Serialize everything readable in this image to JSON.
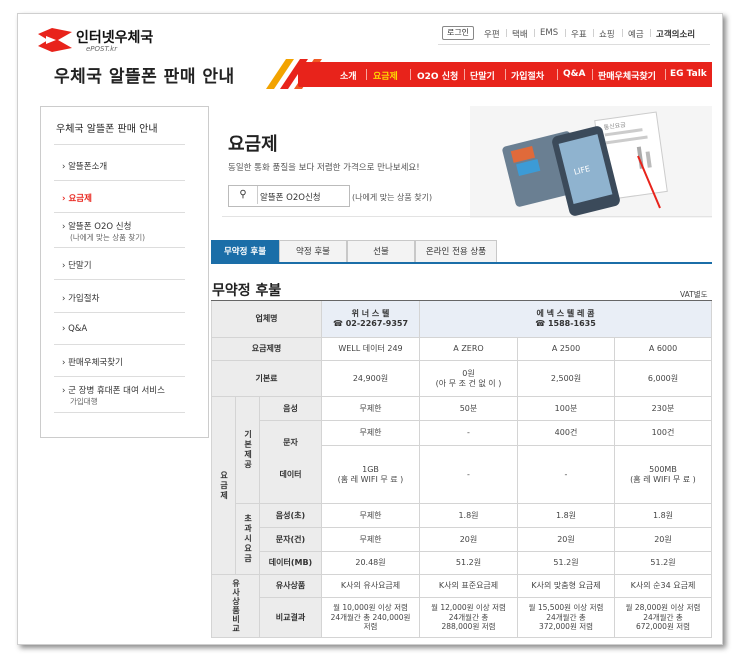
{
  "brand": {
    "name": "인터넷우체국",
    "sub": "ePOST.kr"
  },
  "site_title": "우체국 알뜰폰 판매 안내",
  "util_nav": {
    "login": "로그인",
    "items": [
      "우편",
      "택배",
      "EMS",
      "우표",
      "쇼핑",
      "예금"
    ],
    "customer": "고객의소리"
  },
  "gnb": [
    "소개",
    "요금제",
    "O2O 신청",
    "단말기",
    "가입절차",
    "Q&A",
    "판매우체국찾기",
    "EG Talk"
  ],
  "gnb_active": "요금제",
  "sidebar": {
    "title": "우체국 알뜰폰 판매 안내",
    "items": [
      {
        "label": "알뜰폰소개"
      },
      {
        "label": "요금제"
      },
      {
        "label": "알뜰폰 O2O 신청",
        "sub": "(나에게 맞는 상품 찾기)"
      },
      {
        "label": "단말기"
      },
      {
        "label": "가입절차"
      },
      {
        "label": "Q&A"
      },
      {
        "label": "판매우체국찾기"
      },
      {
        "label": "군 장병 휴대폰 대여 서비스",
        "sub": "가입대행"
      }
    ]
  },
  "page": {
    "title": "요금제",
    "desc": "동일한 통화 품질을 보다 저렴한 가격으로 만나보세요!",
    "search_icon": "search-icon",
    "search_label": "알뜰폰 O2O신청",
    "search_hint": "(나에게 맞는 상품 찾기)",
    "hero_doc_label": "통신요금",
    "hero_phone_label": "LIFE"
  },
  "tabs": [
    "무약정 후불",
    "약정 후불",
    "선불",
    "온라인 전용 상품"
  ],
  "section": {
    "title": "무약정 후불",
    "vat": "VAT별도"
  },
  "table": {
    "head_operator": "업체명",
    "head_plan": "요금제명",
    "head_base": "기본료",
    "group_fee": "요금제",
    "group_basic": "기본제공",
    "group_over": "초과시요금",
    "group_compare": "유사상품비교",
    "row_voice": "음성",
    "row_sms": "문자",
    "row_data": "데이터",
    "row_voice_over": "음성(초)",
    "row_sms_over": "문자(건)",
    "row_data_over": "데이터(MB)",
    "row_similar": "유사상품",
    "row_compare": "비교결과",
    "operators": [
      {
        "name": "위 너 스 텔",
        "phone": "☎ 02-2267-9357"
      },
      {
        "name": "에 넥 스 텔 레 콤",
        "phone": "☎ 1588-1635"
      }
    ],
    "plans": [
      {
        "name": "WELL 데이터 249",
        "base": "24,900원",
        "voice": "무제한",
        "sms": "무제한",
        "data": "1GB",
        "data_note": "(홈 레 WIFI 무 료 )",
        "voice_over": "무제한",
        "sms_over": "무제한",
        "data_over": "20.48원",
        "similar": "K사의 유사요금제",
        "compare": [
          "월 10,000원 이상 저렴",
          "24개월간 총 240,000원",
          "저렴"
        ]
      },
      {
        "name": "A ZERO",
        "base": "0원",
        "base_note": "(아 무 조 건 없 이 )",
        "voice": "50분",
        "sms": "-",
        "data": "-",
        "voice_over": "1.8원",
        "sms_over": "20원",
        "data_over": "51.2원",
        "similar": "K사의 표준요금제",
        "compare": [
          "월 12,000원 이상 저렴",
          "24개월간 총",
          "288,000원 저렴"
        ]
      },
      {
        "name": "A 2500",
        "base": "2,500원",
        "voice": "100분",
        "sms": "400건",
        "data": "-",
        "voice_over": "1.8원",
        "sms_over": "20원",
        "data_over": "51.2원",
        "similar": "K사의 맞춤형 요금제",
        "compare": [
          "월 15,500원 이상 저렴",
          "24개월간 총",
          "372,000원 저렴"
        ]
      },
      {
        "name": "A 6000",
        "base": "6,000원",
        "voice": "230분",
        "sms": "100건",
        "data": "500MB",
        "data_note": "(홈 레 WIFI 무 료 )",
        "voice_over": "1.8원",
        "sms_over": "20원",
        "data_over": "51.2원",
        "similar": "K사의 순34 요금제",
        "compare": [
          "월 28,000원 이상 저렴",
          "24개월간 총",
          "672,000원 저렴"
        ]
      }
    ]
  },
  "colors": {
    "accent": "#e8231b",
    "tab_active": "#1b6ea8",
    "gnb_active_text": "#ffd800"
  }
}
